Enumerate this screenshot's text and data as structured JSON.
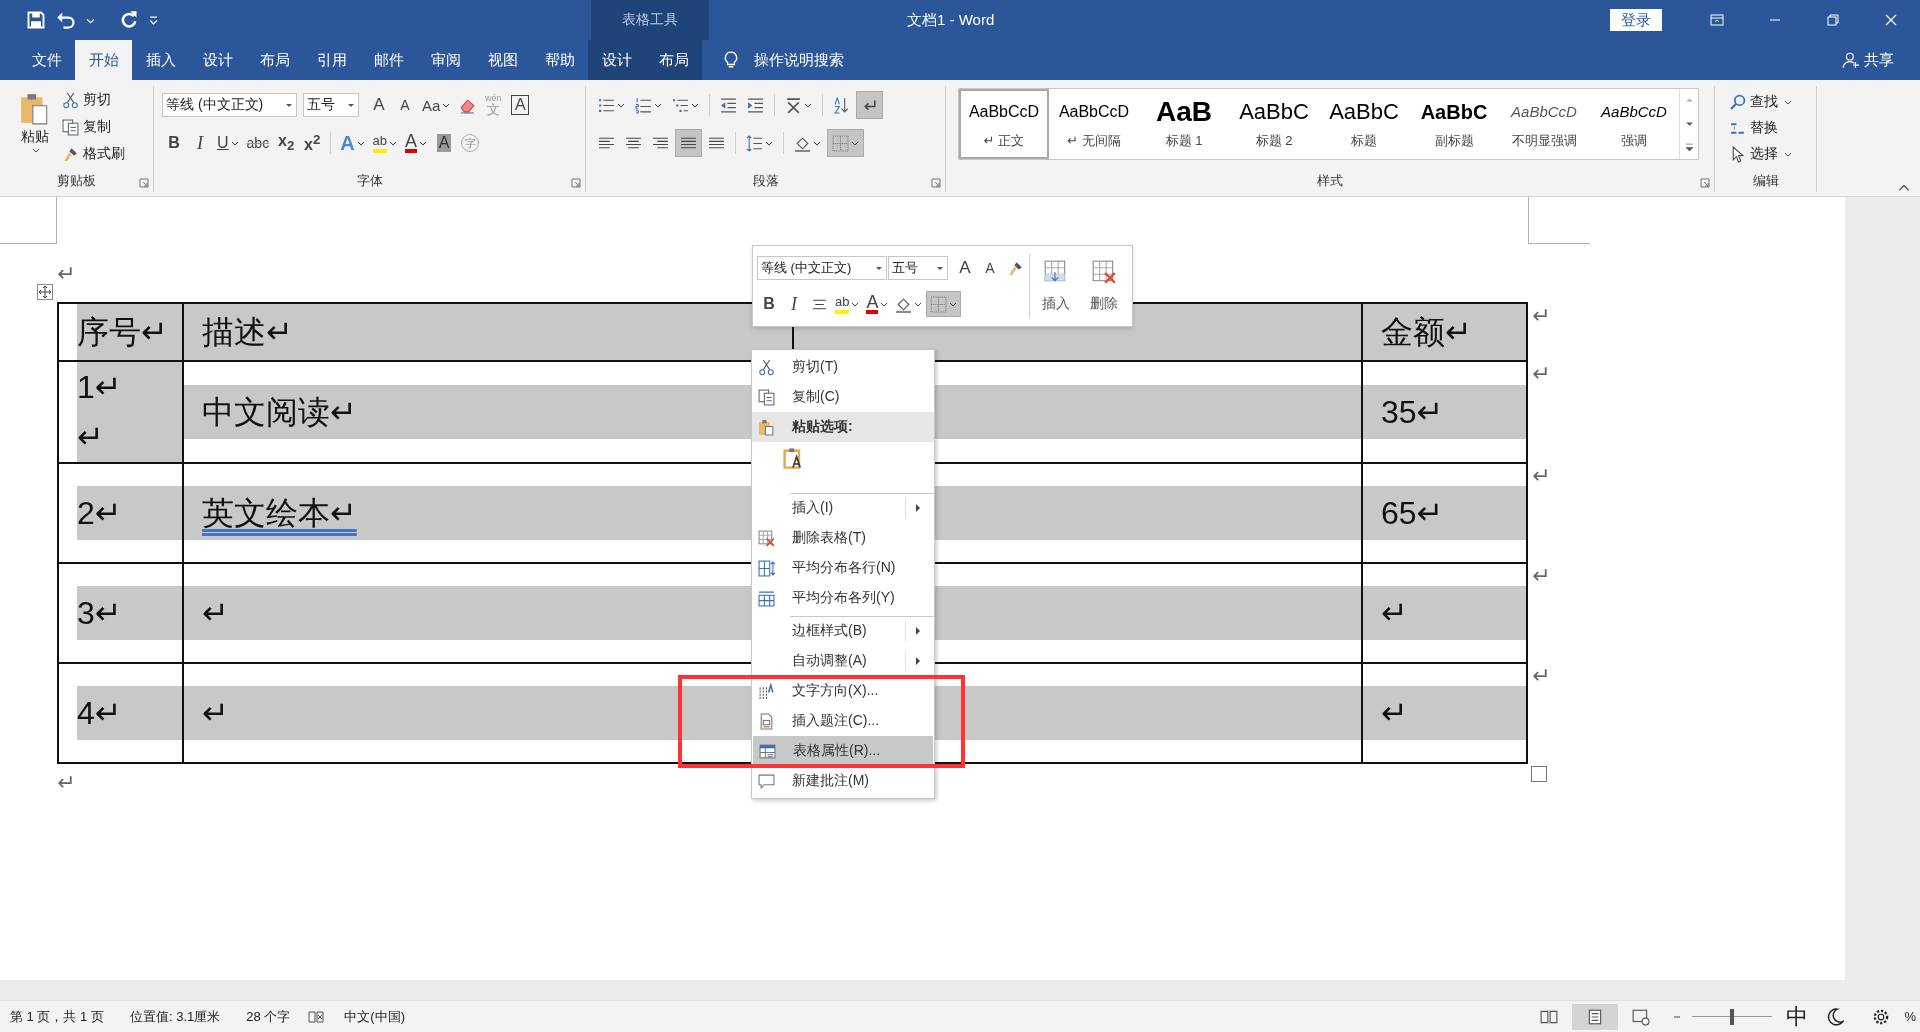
{
  "window": {
    "title": "文档1 - Word",
    "contextual_group": "表格工具",
    "sign_in": "登录"
  },
  "tabs": [
    {
      "label": "文件",
      "selected": false,
      "contextual": false
    },
    {
      "label": "开始",
      "selected": true,
      "contextual": false
    },
    {
      "label": "插入",
      "selected": false,
      "contextual": false
    },
    {
      "label": "设计",
      "selected": false,
      "contextual": false
    },
    {
      "label": "布局",
      "selected": false,
      "contextual": false
    },
    {
      "label": "引用",
      "selected": false,
      "contextual": false
    },
    {
      "label": "邮件",
      "selected": false,
      "contextual": false
    },
    {
      "label": "审阅",
      "selected": false,
      "contextual": false
    },
    {
      "label": "视图",
      "selected": false,
      "contextual": false
    },
    {
      "label": "帮助",
      "selected": false,
      "contextual": false
    },
    {
      "label": "设计",
      "selected": false,
      "contextual": true
    },
    {
      "label": "布局",
      "selected": false,
      "contextual": true
    }
  ],
  "tell_me": "操作说明搜索",
  "share": "共享",
  "ribbon": {
    "clipboard": {
      "label": "剪贴板",
      "paste": "粘贴",
      "items": [
        "剪切",
        "复制",
        "格式刷"
      ]
    },
    "font": {
      "label": "字体",
      "font_name": "等线 (中文正文)",
      "font_size": "五号",
      "row1": [
        {
          "text": "A",
          "kind": "grow"
        },
        {
          "text": "A",
          "kind": "shrink"
        },
        {
          "text": "Aa",
          "kind": "case"
        },
        {
          "text": "文",
          "kind": "phonetic",
          "ruby": "wén"
        },
        {
          "text": "A",
          "kind": "border"
        }
      ],
      "row2": [
        {
          "text": "B",
          "kind": "bold"
        },
        {
          "text": "I",
          "kind": "italic"
        },
        {
          "text": "U",
          "kind": "underline"
        },
        {
          "text": "abc",
          "kind": "strike"
        },
        {
          "text": "x$_{2}$",
          "kind": "sub"
        },
        {
          "text": "x$^{2}$",
          "kind": "sup"
        },
        {
          "text": "A",
          "kind": "effects"
        },
        {
          "text": "ab",
          "kind": "highlight"
        },
        {
          "text": "A",
          "kind": "color"
        },
        {
          "text": "A",
          "kind": "shading"
        },
        {
          "text": "字",
          "kind": "enclose"
        }
      ]
    },
    "paragraph": {
      "label": "段落",
      "show_marks": true,
      "alignments": [
        {
          "selected": false
        },
        {
          "selected": false
        },
        {
          "selected": false
        },
        {
          "selected": true
        },
        {
          "selected": false
        }
      ]
    },
    "styles": {
      "label": "样式",
      "items": [
        {
          "preview": "AaBbCcD",
          "label": "↵ 正文",
          "kind": "normal",
          "selected": true
        },
        {
          "preview": "AaBbCcD",
          "label": "↵ 无间隔",
          "kind": "normal",
          "selected": false
        },
        {
          "preview": "AaB",
          "label": "标题 1",
          "kind": "heading1",
          "selected": false
        },
        {
          "preview": "AaBbC",
          "label": "标题 2",
          "kind": "heading2",
          "selected": false
        },
        {
          "preview": "AaBbC",
          "label": "标题",
          "kind": "title",
          "selected": false
        },
        {
          "preview": "AaBbC",
          "label": "副标题",
          "kind": "subtitle",
          "selected": false
        },
        {
          "preview": "AaBbCcD",
          "label": "不明显强调",
          "kind": "subtle",
          "selected": false
        },
        {
          "preview": "AaBbCcD",
          "label": "强调",
          "kind": "emphasis",
          "selected": false
        }
      ]
    },
    "editing": {
      "label": "编辑",
      "items": [
        "查找",
        "替换",
        "选择"
      ]
    }
  },
  "document": {
    "paragraph_before": "↵",
    "paragraph_after": "↵",
    "table": {
      "rows": [
        {
          "end_mark": "↵",
          "cells": [
            {
              "lines": [
                "序号↵"
              ],
              "flagged": false
            },
            {
              "lines": [
                "描述↵"
              ],
              "flagged": false
            },
            {
              "shaded": true
            },
            {
              "lines": [
                "金额↵"
              ],
              "flagged": false
            }
          ]
        },
        {
          "end_mark": "↵",
          "cells": [
            {
              "lines": [
                "1↵",
                "↵"
              ],
              "flagged": false
            },
            {
              "lines": [
                "中文阅读↵"
              ],
              "flagged": false
            },
            {
              "shaded": true
            },
            {
              "lines": [
                "35↵"
              ],
              "flagged": false
            }
          ]
        },
        {
          "end_mark": "↵",
          "cells": [
            {
              "lines": [
                "2↵"
              ],
              "flagged": false
            },
            {
              "lines": [
                "英文绘本↵"
              ],
              "flagged": true
            },
            {
              "shaded": true
            },
            {
              "lines": [
                "65↵"
              ],
              "flagged": false
            }
          ]
        },
        {
          "end_mark": "↵",
          "cells": [
            {
              "lines": [
                "3↵"
              ],
              "flagged": false
            },
            {
              "lines": [
                "↵"
              ],
              "flagged": false
            },
            {
              "shaded": true
            },
            {
              "lines": [
                "↵"
              ],
              "flagged": false
            }
          ]
        },
        {
          "end_mark": "↵",
          "cells": [
            {
              "lines": [
                "4↵"
              ],
              "flagged": false
            },
            {
              "lines": [
                "↵"
              ],
              "flagged": false
            },
            {
              "shaded": true
            },
            {
              "lines": [
                "↵"
              ],
              "flagged": false
            }
          ]
        }
      ]
    }
  },
  "mini_toolbar": {
    "font_name": "等线 (中文正文)",
    "font_size": "五号",
    "grow": "A",
    "shrink": "A",
    "bold": "B",
    "italic": "I",
    "highlight": "ab",
    "font_color": "A",
    "insert": "插入",
    "delete": "删除"
  },
  "context_menu": {
    "items": [
      {
        "label": "剪切(T)",
        "kind": "item",
        "selected": false,
        "separator_before": false
      },
      {
        "label": "复制(C)",
        "kind": "item",
        "selected": false,
        "separator_before": false
      },
      {
        "label": "粘贴选项:",
        "kind": "header",
        "separator_before": false
      },
      {
        "kind": "paste-options",
        "separator_before": false
      },
      {
        "label": "插入(I)",
        "kind": "submenu",
        "selected": false,
        "separator_before": true
      },
      {
        "label": "删除表格(T)",
        "kind": "item",
        "selected": false,
        "separator_before": false
      },
      {
        "label": "平均分布各行(N)",
        "kind": "item",
        "selected": false,
        "separator_before": false
      },
      {
        "label": "平均分布各列(Y)",
        "kind": "item",
        "selected": false,
        "separator_before": false
      },
      {
        "label": "边框样式(B)",
        "kind": "submenu",
        "selected": false,
        "separator_before": true
      },
      {
        "label": "自动调整(A)",
        "kind": "submenu",
        "selected": false,
        "separator_before": false
      },
      {
        "label": "文字方向(X)...",
        "kind": "item",
        "selected": false,
        "separator_before": false
      },
      {
        "label": "插入题注(C)...",
        "kind": "item",
        "selected": false,
        "separator_before": false
      },
      {
        "label": "表格属性(R)...",
        "kind": "item",
        "selected": true,
        "separator_before": false
      },
      {
        "label": "新建批注(M)",
        "kind": "item",
        "selected": false,
        "separator_before": false
      }
    ]
  },
  "status_bar": {
    "items": [
      "第 1 页，共 1 页",
      "位置值: 3.1厘米",
      "28 个字",
      "中文(中国)"
    ],
    "zoom": {
      "level": 0.5
    },
    "ime": "中",
    "zoom_percent": "%"
  }
}
